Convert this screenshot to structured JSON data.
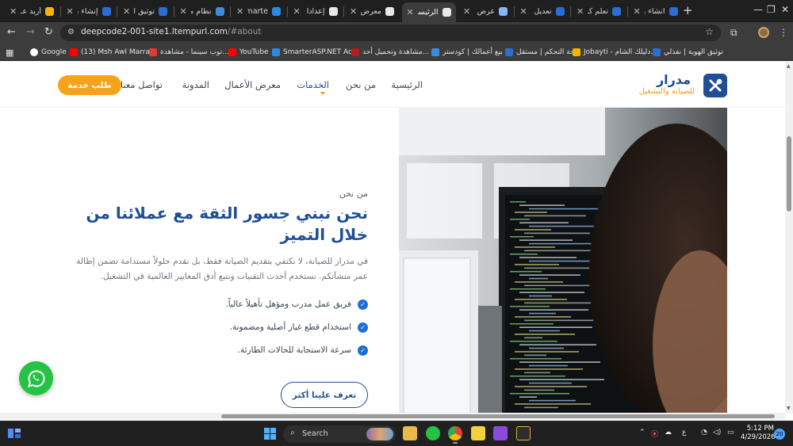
{
  "browser": {
    "tabs": [
      {
        "label": "أريد عـ",
        "favicon": "#f5b400",
        "active": false
      },
      {
        "label": "إنشاء بر",
        "favicon": "#2b6dd3",
        "active": false
      },
      {
        "label": "توثيق ا",
        "favicon": "#2b6dd3",
        "active": false
      },
      {
        "label": "نظام مـ",
        "favicon": "#3e8bd9",
        "active": false
      },
      {
        "label": "Smarte",
        "favicon": "#2a8be0",
        "active": false
      },
      {
        "label": "إعدادا",
        "favicon": "#e8e8e8",
        "active": false
      },
      {
        "label": "معرض",
        "favicon": "#e8e8e8",
        "active": false
      },
      {
        "label": "الرئيسي",
        "favicon": "#e8e8e8",
        "active": true
      },
      {
        "label": "عرض م",
        "favicon": "#8ab4f8",
        "active": false
      },
      {
        "label": "تعديل",
        "favicon": "#2b6dd3",
        "active": false
      },
      {
        "label": "تعلم كـ",
        "favicon": "#2b6dd3",
        "active": false
      },
      {
        "label": "انشاء بر",
        "favicon": "#2b6dd3",
        "active": false
      }
    ],
    "url_host": "deepcode2-001-site1.ltempurl.com",
    "url_path": "/#about",
    "bookmarks": [
      {
        "label": "Google",
        "color": "#ffffff"
      },
      {
        "label": "(13) Msh Awl Marra...",
        "color": "#ff0000"
      },
      {
        "label": "توب سينما - مشاهدة...",
        "color": "#e53935"
      },
      {
        "label": "YouTube",
        "color": "#ff0000"
      },
      {
        "label": "SmarterASP.NET Ac...",
        "color": "#2a8be0"
      },
      {
        "label": "مشاهدة وتحميل أحد...",
        "color": "#b71c1c"
      },
      {
        "label": "بيع أعمالك | كودستر",
        "color": "#3e8bd9"
      },
      {
        "label": "لوحة التحكم | مستقل",
        "color": "#2b6dd3"
      },
      {
        "label": "Jobayti - دليلك الشام...",
        "color": "#f5b400"
      },
      {
        "label": "توثيق الهوية | نفذلي",
        "color": "#2b6dd3"
      }
    ]
  },
  "site": {
    "logo_name": "مدرار",
    "logo_sub": "للصيانة والتشغيل",
    "nav": [
      "الرئيسية",
      "من نحن",
      "الخدمات",
      "معرض الأعمال",
      "المدونة",
      "تواصل معنا"
    ],
    "cta_label": "طلب خدمة",
    "eyebrow": "من نحن",
    "headline": "نحن نبني جسور الثقة مع عملائنا من خلال التميز",
    "lead": "في مدرار للصيانة، لا نكتفي بتقديم الصيانة فقط، بل نقدم حلولاً مستدامة تضمن إطالة عمر منشآتكم. نستخدم أحدث التقنيات ونتبع أدق المعايير العالمية في التشغيل.",
    "features": [
      "فريق عمل مدرب ومؤهل تأهيلاً عالياً.",
      "استخدام قطع غيار أصلية ومضمونة.",
      "سرعة الاستجابة للحالات الطارئة."
    ],
    "more_label": "تعرف علينا أكثر",
    "brand_color": "#1f4e96",
    "accent_color": "#f7a21b"
  },
  "taskbar": {
    "search_label": "Search",
    "time": "5:12 PM",
    "date": "4/29/2026",
    "lang": "ع",
    "notification_count": "20"
  }
}
